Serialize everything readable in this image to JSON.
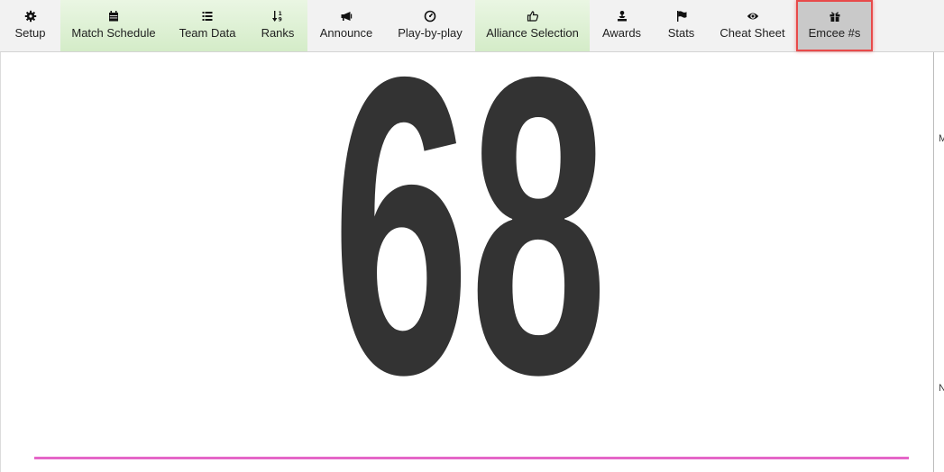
{
  "nav": {
    "items": [
      {
        "name": "setup",
        "label": "Setup",
        "icon": "gear-icon",
        "style": "plain",
        "active": false
      },
      {
        "name": "match-schedule",
        "label": "Match Schedule",
        "icon": "calendar-icon",
        "style": "green",
        "active": false
      },
      {
        "name": "team-data",
        "label": "Team Data",
        "icon": "list-icon",
        "style": "green",
        "active": false
      },
      {
        "name": "ranks",
        "label": "Ranks",
        "icon": "sort-icon",
        "style": "green",
        "active": false
      },
      {
        "name": "announce",
        "label": "Announce",
        "icon": "megaphone-icon",
        "style": "plain",
        "active": false
      },
      {
        "name": "play-by-play",
        "label": "Play-by-play",
        "icon": "dashboard-icon",
        "style": "plain",
        "active": false
      },
      {
        "name": "alliance-selection",
        "label": "Alliance Selection",
        "icon": "thumbs-up-icon",
        "style": "green",
        "active": false
      },
      {
        "name": "awards",
        "label": "Awards",
        "icon": "trophy-icon",
        "style": "plain",
        "active": false
      },
      {
        "name": "stats",
        "label": "Stats",
        "icon": "flag-icon",
        "style": "plain",
        "active": false
      },
      {
        "name": "cheat-sheet",
        "label": "Cheat Sheet",
        "icon": "eye-icon",
        "style": "plain",
        "active": false
      },
      {
        "name": "emcee-numbers",
        "label": "Emcee #s",
        "icon": "gift-icon",
        "style": "plain",
        "active": true
      }
    ]
  },
  "display": {
    "number": "68",
    "number_color": "#333333",
    "underline_color": "#e566c8"
  },
  "colors": {
    "nav_background": "#f2f2f2",
    "nav_green": "#d4ecc8",
    "active_background": "#c9c9c9",
    "active_border": "#e84a4a"
  },
  "edge_fragments": [
    "M",
    "N"
  ]
}
